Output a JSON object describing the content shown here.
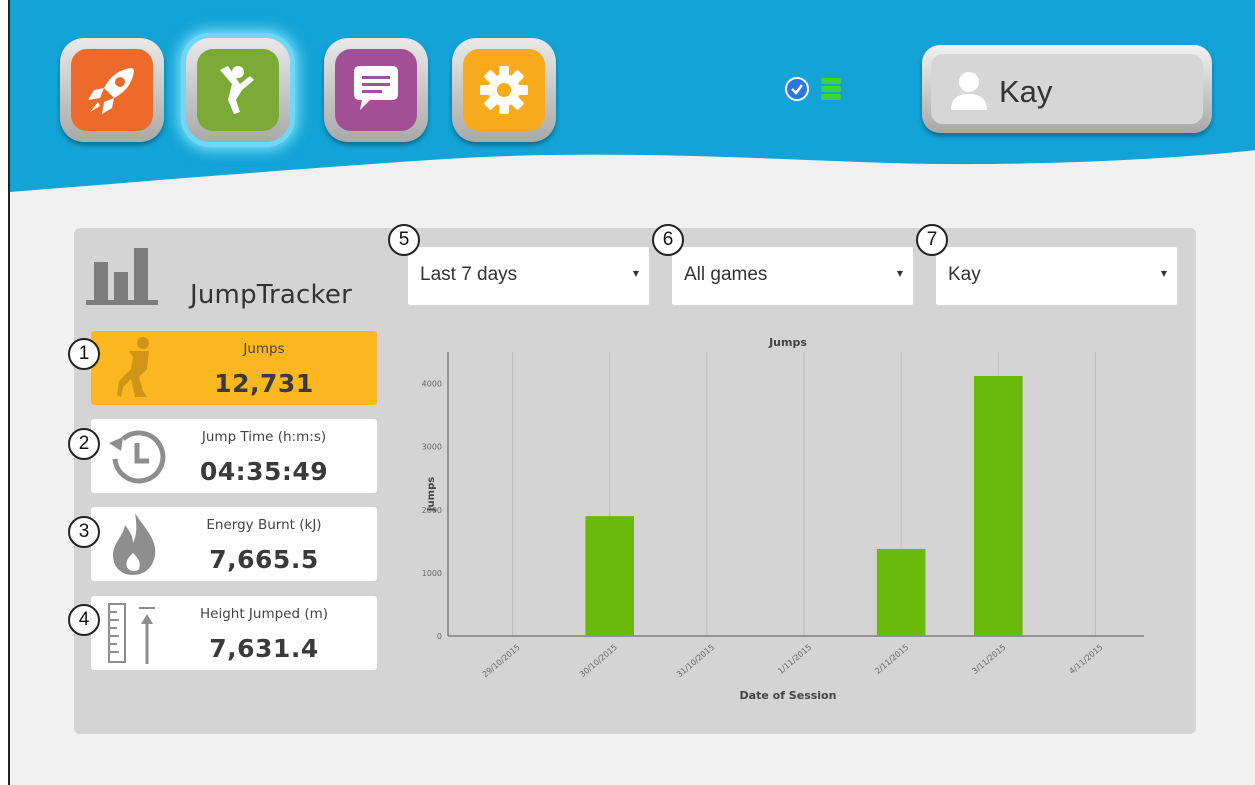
{
  "topbar": {
    "apps": [
      {
        "name": "rocket",
        "color": "#ee6a2b"
      },
      {
        "name": "jump",
        "color": "#7bab36"
      },
      {
        "name": "chat",
        "color": "#a24f96"
      },
      {
        "name": "settings",
        "color": "#f7ab1c"
      }
    ],
    "user": "Kay",
    "bar_color": "#13a3d6"
  },
  "sidebar": {
    "title": "JumpTracker",
    "metrics": [
      {
        "badge": "1",
        "label": "Jumps",
        "value": "12,731",
        "icon": "jumper-icon"
      },
      {
        "badge": "2",
        "label": "Jump Time (h:m:s)",
        "value": "04:35:49",
        "icon": "clock-icon"
      },
      {
        "badge": "3",
        "label": "Energy Burnt (kJ)",
        "value": "7,665.5",
        "icon": "flame-icon"
      },
      {
        "badge": "4",
        "label": "Height Jumped (m)",
        "value": "7,631.4",
        "icon": "ruler-icon"
      }
    ]
  },
  "filters": {
    "period": {
      "badge": "5",
      "value": "Last 7 days"
    },
    "game": {
      "badge": "6",
      "value": "All games"
    },
    "player": {
      "badge": "7",
      "value": "Kay"
    }
  },
  "chart_data": {
    "type": "bar",
    "title": "Jumps",
    "xlabel": "Date of Session",
    "ylabel": "Jumps",
    "categories": [
      "29/10/2015",
      "30/10/2015",
      "31/10/2015",
      "1/11/2015",
      "2/11/2015",
      "3/11/2015",
      "4/11/2015"
    ],
    "values": [
      0,
      1900,
      0,
      0,
      1380,
      4120,
      0
    ],
    "yticks": [
      0,
      1000,
      2000,
      3000,
      4000
    ],
    "ylim": [
      0,
      4500
    ],
    "bar_color": "#6aba0c",
    "grid": "vertical"
  }
}
